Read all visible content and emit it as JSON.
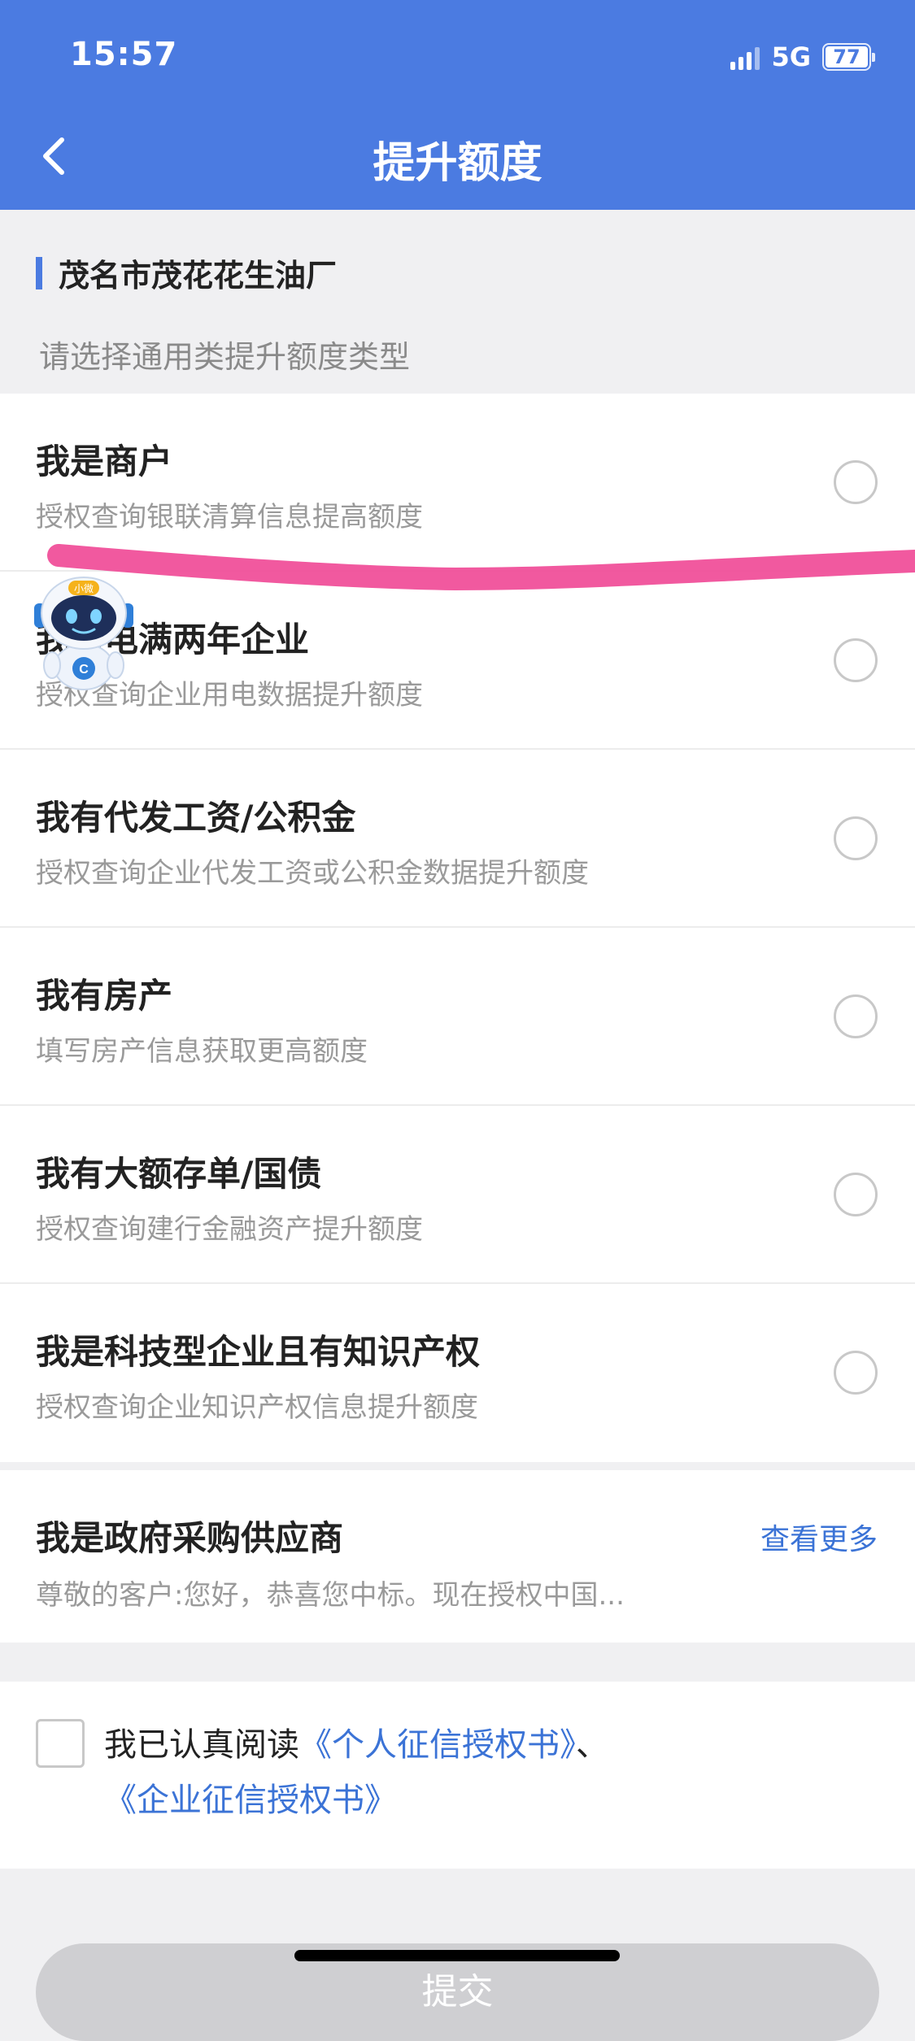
{
  "status_bar": {
    "time": "15:57",
    "network": "5G",
    "battery": "77"
  },
  "header": {
    "title": "提升额度"
  },
  "company": {
    "name": "茂名市茂花花生油厂"
  },
  "prompt": "请选择通用类提升额度类型",
  "options": [
    {
      "title": "我是商户",
      "desc": "授权查询银联清算信息提高额度"
    },
    {
      "title": "我用电满两年企业",
      "desc": "授权查询企业用电数据提升额度"
    },
    {
      "title": "我有代发工资/公积金",
      "desc": "授权查询企业代发工资或公积金数据提升额度"
    },
    {
      "title": "我有房产",
      "desc": "填写房产信息获取更高额度"
    },
    {
      "title": "我有大额存单/国债",
      "desc": "授权查询建行金融资产提升额度"
    },
    {
      "title": "我是科技型企业且有知识产权",
      "desc": "授权查询企业知识产权信息提升额度"
    }
  ],
  "gov": {
    "title": "我是政府采购供应商",
    "more": "查看更多",
    "desc": "尊敬的客户:您好，恭喜您中标。现在授权中国..."
  },
  "agreement": {
    "prefix": "我已认真阅读",
    "link1": "《个人征信授权书》",
    "separator": "、",
    "link2": "《企业征信授权书》"
  },
  "submit": {
    "label": "提交"
  },
  "robot": {
    "badge": "小微"
  },
  "colors": {
    "primary": "#4b7be1",
    "link": "#3b73d6",
    "highlight": "#f0509a"
  }
}
